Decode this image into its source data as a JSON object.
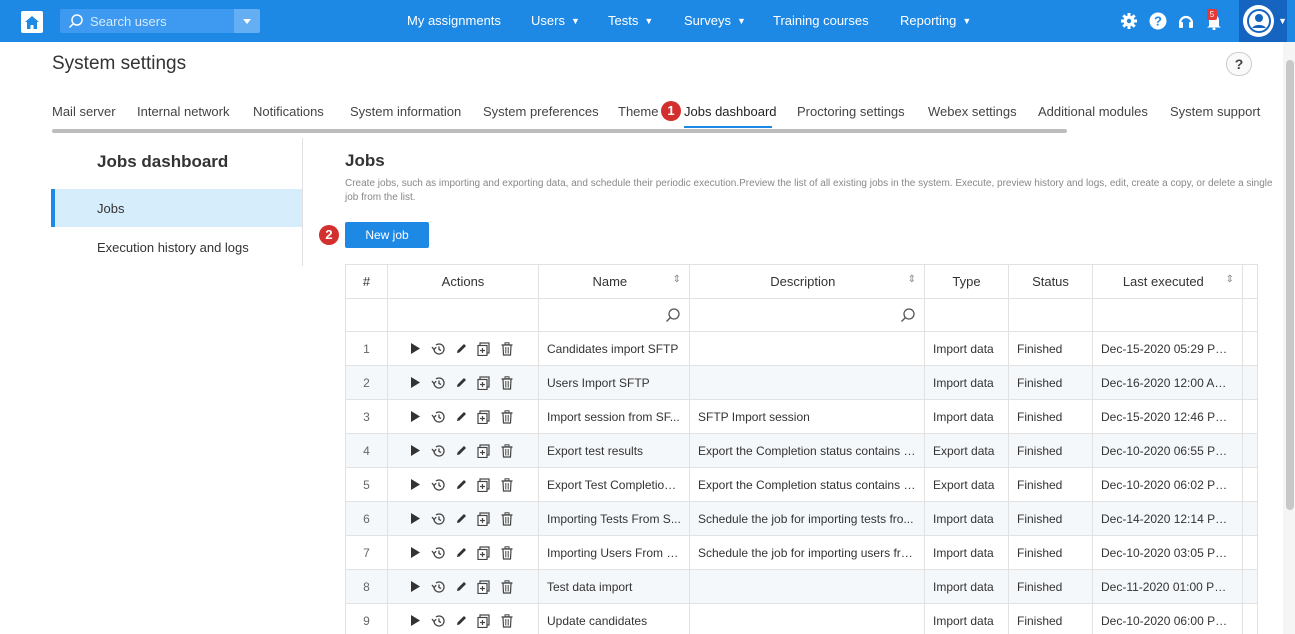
{
  "topbar": {
    "search_placeholder": "Search users",
    "nav": [
      {
        "label": "My assignments",
        "dropdown": false
      },
      {
        "label": "Users",
        "dropdown": true
      },
      {
        "label": "Tests",
        "dropdown": true
      },
      {
        "label": "Surveys",
        "dropdown": true
      },
      {
        "label": "Training courses",
        "dropdown": false
      },
      {
        "label": "Reporting",
        "dropdown": true
      }
    ],
    "notification_count": "5",
    "icons": [
      "home-icon",
      "search-icon",
      "gear-icon",
      "help-icon",
      "headset-icon",
      "bell-icon",
      "user-avatar-icon"
    ]
  },
  "header": {
    "title": "System settings",
    "help": "?"
  },
  "tabs": [
    "Mail server",
    "Internal network",
    "Notifications",
    "System information",
    "System preferences",
    "Theme",
    "Jobs dashboard",
    "Proctoring settings",
    "Webex settings",
    "Additional modules",
    "System support"
  ],
  "active_tab": "Jobs dashboard",
  "markers": [
    "1",
    "2"
  ],
  "sidebar": {
    "title": "Jobs dashboard",
    "items": [
      {
        "label": "Jobs",
        "active": true
      },
      {
        "label": "Execution history and logs",
        "active": false
      }
    ]
  },
  "main": {
    "title": "Jobs",
    "description": "Create jobs, such as importing and exporting data, and schedule their periodic execution.Preview the list of all existing jobs in the system. Execute, preview history and logs, edit, create a copy, or delete a single job from the list.",
    "new_job_label": "New job"
  },
  "table": {
    "headers": [
      "#",
      "Actions",
      "Name",
      "Description",
      "Type",
      "Status",
      "Last executed"
    ],
    "rows": [
      {
        "num": "1",
        "name": "Candidates import SFTP",
        "description": "",
        "type": "Import data",
        "status": "Finished",
        "last": "Dec-15-2020 05:29 PM ..."
      },
      {
        "num": "2",
        "name": "Users Import SFTP",
        "description": "",
        "type": "Import data",
        "status": "Finished",
        "last": "Dec-16-2020 12:00 AM ..."
      },
      {
        "num": "3",
        "name": "Import session from SF...",
        "description": "SFTP Import session",
        "type": "Import data",
        "status": "Finished",
        "last": "Dec-15-2020 12:46 PM ..."
      },
      {
        "num": "4",
        "name": "Export test results",
        "description": "Export the Completion status contains a...",
        "type": "Export data",
        "status": "Finished",
        "last": "Dec-10-2020 06:55 PM ..."
      },
      {
        "num": "5",
        "name": "Export Test Completion ...",
        "description": "Export the Completion status contains a...",
        "type": "Export data",
        "status": "Finished",
        "last": "Dec-10-2020 06:02 PM ..."
      },
      {
        "num": "6",
        "name": "Importing Tests From S...",
        "description": "Schedule the job for importing tests fro...",
        "type": "Import data",
        "status": "Finished",
        "last": "Dec-14-2020 12:14 PM ..."
      },
      {
        "num": "7",
        "name": "Importing Users From F...",
        "description": "Schedule the job for importing users fro...",
        "type": "Import data",
        "status": "Finished",
        "last": "Dec-10-2020 03:05 PM ..."
      },
      {
        "num": "8",
        "name": "Test data import",
        "description": "",
        "type": "Import data",
        "status": "Finished",
        "last": "Dec-11-2020 01:00 PM ..."
      },
      {
        "num": "9",
        "name": "Update candidates",
        "description": "",
        "type": "Import data",
        "status": "Finished",
        "last": "Dec-10-2020 06:00 PM ..."
      }
    ],
    "row_actions": [
      "execute-icon",
      "history-icon",
      "edit-icon",
      "copy-icon",
      "delete-icon"
    ]
  }
}
